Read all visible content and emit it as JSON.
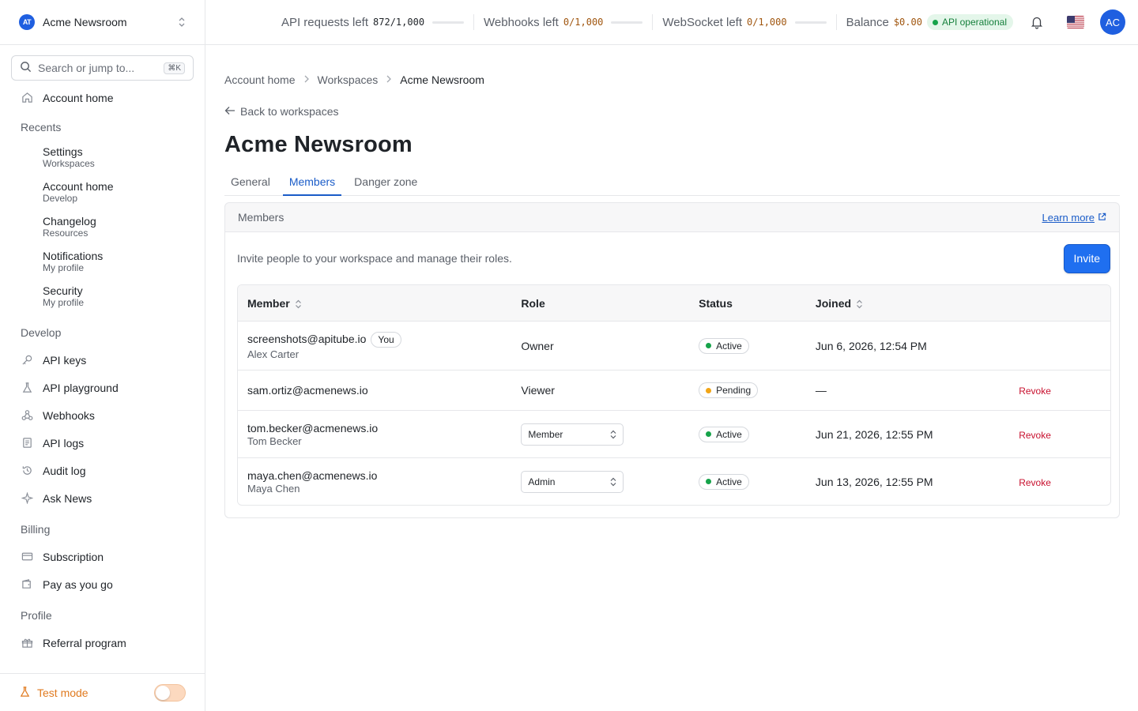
{
  "sidebar": {
    "workspace_name": "Acme Newsroom",
    "workspace_logo": "AT",
    "search_placeholder": "Search or jump to...",
    "search_shortcut": "⌘K",
    "account_home": "Account home",
    "recents_label": "Recents",
    "recents": [
      {
        "title": "Settings",
        "subtitle": "Workspaces"
      },
      {
        "title": "Account home",
        "subtitle": "Develop"
      },
      {
        "title": "Changelog",
        "subtitle": "Resources"
      },
      {
        "title": "Notifications",
        "subtitle": "My profile"
      },
      {
        "title": "Security",
        "subtitle": "My profile"
      }
    ],
    "develop_label": "Develop",
    "develop_items": [
      {
        "label": "API keys",
        "icon": "key-icon"
      },
      {
        "label": "API playground",
        "icon": "flask-icon"
      },
      {
        "label": "Webhooks",
        "icon": "webhook-icon"
      },
      {
        "label": "API logs",
        "icon": "logs-icon"
      },
      {
        "label": "Audit log",
        "icon": "history-icon"
      },
      {
        "label": "Ask News",
        "icon": "sparkle-icon"
      }
    ],
    "billing_label": "Billing",
    "billing_items": [
      {
        "label": "Subscription",
        "icon": "credit-card-icon"
      },
      {
        "label": "Pay as you go",
        "icon": "wallet-icon"
      }
    ],
    "profile_label": "Profile",
    "profile_items": [
      {
        "label": "Referral program",
        "icon": "gift-icon"
      }
    ],
    "test_mode_label": "Test mode",
    "test_mode_on": false
  },
  "topbar": {
    "api_requests_label": "API requests left",
    "api_requests_value": "872/1,000",
    "api_requests_fraction": 0.0,
    "webhooks_label": "Webhooks left",
    "webhooks_value": "0/1,000",
    "websocket_label": "WebSocket left",
    "websocket_value": "0/1,000",
    "balance_label": "Balance",
    "balance_value": "$0.00",
    "status_text": "API operational",
    "avatar_initials": "AC",
    "colors": {
      "accent": "#1f5fe0",
      "status_green": "#16803c",
      "warn": "#a0560f"
    }
  },
  "breadcrumb": [
    "Account home",
    "Workspaces",
    "Acme Newsroom"
  ],
  "back_link": "Back to workspaces",
  "page_title": "Acme Newsroom",
  "tabs": [
    {
      "label": "General",
      "active": false
    },
    {
      "label": "Members",
      "active": true
    },
    {
      "label": "Danger zone",
      "active": false
    }
  ],
  "members_card": {
    "heading": "Members",
    "learn_more": "Learn more",
    "intro": "Invite people to your workspace and manage their roles.",
    "invite_label": "Invite",
    "columns": [
      "Member",
      "Role",
      "Status",
      "Joined"
    ],
    "rows": [
      {
        "email": "screenshots@apitube.io",
        "name": "Alex Carter",
        "you_badge": "You",
        "role": "Owner",
        "role_editable": false,
        "status": "Active",
        "joined": "Jun 6, 2026, 12:54 PM",
        "action": ""
      },
      {
        "email": "sam.ortiz@acmenews.io",
        "name": "",
        "you_badge": "",
        "role": "Viewer",
        "role_editable": false,
        "status": "Pending",
        "joined": "—",
        "action": "Revoke"
      },
      {
        "email": "tom.becker@acmenews.io",
        "name": "Tom Becker",
        "you_badge": "",
        "role": "Member",
        "role_editable": true,
        "status": "Active",
        "joined": "Jun 21, 2026, 12:55 PM",
        "action": "Revoke"
      },
      {
        "email": "maya.chen@acmenews.io",
        "name": "Maya Chen",
        "you_badge": "",
        "role": "Admin",
        "role_editable": true,
        "status": "Active",
        "joined": "Jun 13, 2026, 12:55 PM",
        "action": "Revoke"
      }
    ],
    "status_colors": {
      "Active": "#16a34a",
      "Pending": "#f2a516"
    }
  }
}
